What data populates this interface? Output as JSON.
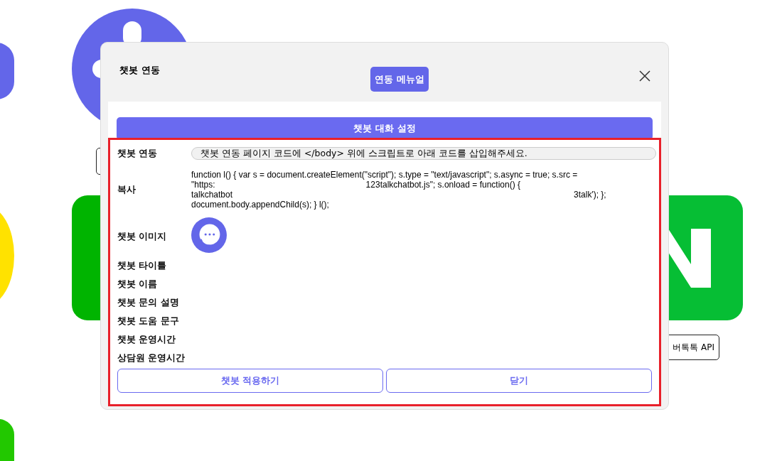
{
  "background": {
    "api_button": "버톡톡 API"
  },
  "modal": {
    "title": "챗봇 연동",
    "manual_button": "연동 메뉴얼",
    "section_bar": "챗봇 대화 설정",
    "rows": [
      {
        "kind": "notice",
        "label": "챗봇 연동",
        "text": "챗봇 연동 페이지 코드에 </body> 위에 스크립트로 아래 코드를 삽입해주세요."
      },
      {
        "kind": "code",
        "label": "복사",
        "lines": [
          [
            "function l() { var s = document.createElement(\"script\"); s.type = \"text/javascript\"; s.async = true; s.src ="
          ],
          [
            "\"https:",
            "123talkchatbot.js\"; s.onload = function() {"
          ],
          [
            "talkchatbot",
            "3talk'); };"
          ],
          [
            "document.body.appendChild(s); } l();"
          ]
        ]
      },
      {
        "kind": "image",
        "label": "챗봇 이미지"
      },
      {
        "kind": "plain",
        "label": "챗봇 타이틀"
      },
      {
        "kind": "plain",
        "label": "챗봇 이름"
      },
      {
        "kind": "plain",
        "label": "챗봇 문의 설명"
      },
      {
        "kind": "plain",
        "label": "챗봇 도움 문구"
      },
      {
        "kind": "plain",
        "label": "챗봇 운영시간"
      },
      {
        "kind": "plain",
        "label": "상담원 운영시간"
      }
    ],
    "buttons": [
      "챗봇 적용하기",
      "닫기"
    ]
  }
}
